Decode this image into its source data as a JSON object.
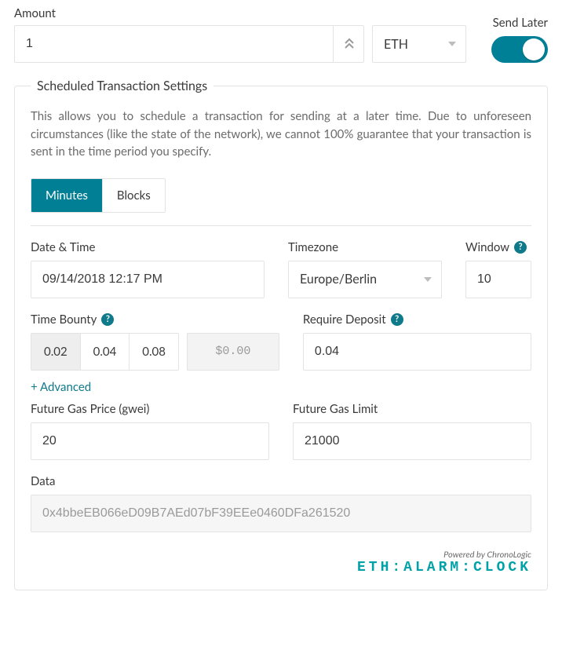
{
  "amount": {
    "label": "Amount",
    "value": "1",
    "currency": "ETH"
  },
  "sendLater": {
    "label": "Send Later",
    "on": true
  },
  "panel": {
    "legend": "Scheduled Transaction Settings",
    "description": "This allows you to schedule a transaction for sending at a later time. Due to unforeseen circumstances (like the state of the network), we cannot 100% guarantee that your transaction is sent in the time period you specify.",
    "tabs": {
      "minutes": "Minutes",
      "blocks": "Blocks",
      "active": "minutes"
    },
    "datetime": {
      "label": "Date & Time",
      "value": "09/14/2018 12:17 PM"
    },
    "timezone": {
      "label": "Timezone",
      "value": "Europe/Berlin"
    },
    "window": {
      "label": "Window",
      "value": "10"
    },
    "bounty": {
      "label": "Time Bounty",
      "options": [
        "0.02",
        "0.04",
        "0.08"
      ],
      "selected": "0.02",
      "usd": "$0.00"
    },
    "deposit": {
      "label": "Require Deposit",
      "value": "0.04"
    },
    "advanced": "+ Advanced",
    "futureGasPrice": {
      "label": "Future Gas Price (gwei)",
      "value": "20"
    },
    "futureGasLimit": {
      "label": "Future Gas Limit",
      "value": "21000"
    },
    "data": {
      "label": "Data",
      "value": "0x4bbeEB066eD09B7AEd07bF39EEe0460DFa261520"
    },
    "footer": {
      "powered": "Powered by ChronoLogic",
      "brand": "ETH:ALARM:CLOCK"
    }
  }
}
